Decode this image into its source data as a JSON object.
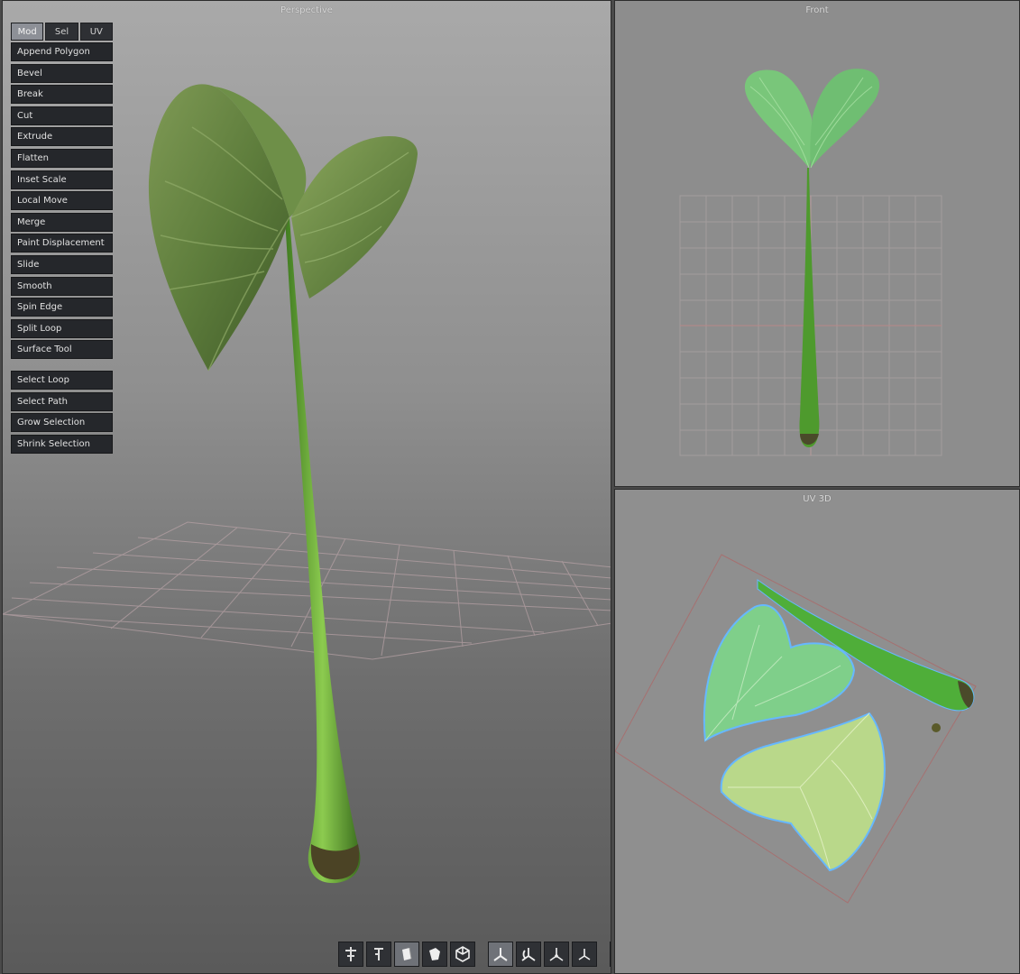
{
  "viewports": {
    "perspective": {
      "title": "Perspective"
    },
    "front": {
      "title": "Front"
    },
    "uv": {
      "title": "UV 3D"
    }
  },
  "tool_tabs": [
    {
      "label": "Mod",
      "active": true
    },
    {
      "label": "Sel",
      "active": false
    },
    {
      "label": "UV",
      "active": false
    }
  ],
  "tools": [
    "Append Polygon",
    "Bevel",
    "Break",
    "Cut",
    "Extrude",
    "Flatten",
    "Inset Scale",
    "Local Move",
    "Merge",
    "Paint Displacement",
    "Slide",
    "Smooth",
    "Spin Edge",
    "Split Loop",
    "Surface Tool"
  ],
  "selection_tools": [
    "Select Loop",
    "Select Path",
    "Grow Selection",
    "Shrink Selection"
  ],
  "toolbar_icons": [
    {
      "name": "move-tool-icon",
      "group": 1
    },
    {
      "name": "scale-tool-icon",
      "group": 1
    },
    {
      "name": "shade-flat-icon",
      "group": 1,
      "active": true
    },
    {
      "name": "shade-smooth-icon",
      "group": 1
    },
    {
      "name": "wireframe-cube-icon",
      "group": 1
    },
    {
      "name": "axis-view-icon",
      "group": 2,
      "active": true
    },
    {
      "name": "axis-rotate-icon",
      "group": 2
    },
    {
      "name": "axis-front-icon",
      "group": 2
    },
    {
      "name": "axis-side-icon",
      "group": 2
    },
    {
      "name": "curve-icon",
      "group": 3
    },
    {
      "name": "grid-icon",
      "group": 3,
      "active": true
    },
    {
      "name": "loop-icon",
      "group": 3
    }
  ],
  "colors": {
    "leaf_dark": "#4f6a35",
    "leaf_mid": "#6f8f48",
    "stem": "#6aa83a",
    "uv_leaf_a": "#7fcf8a",
    "uv_leaf_b": "#b9d88a",
    "uv_outline": "#66b8ff"
  }
}
